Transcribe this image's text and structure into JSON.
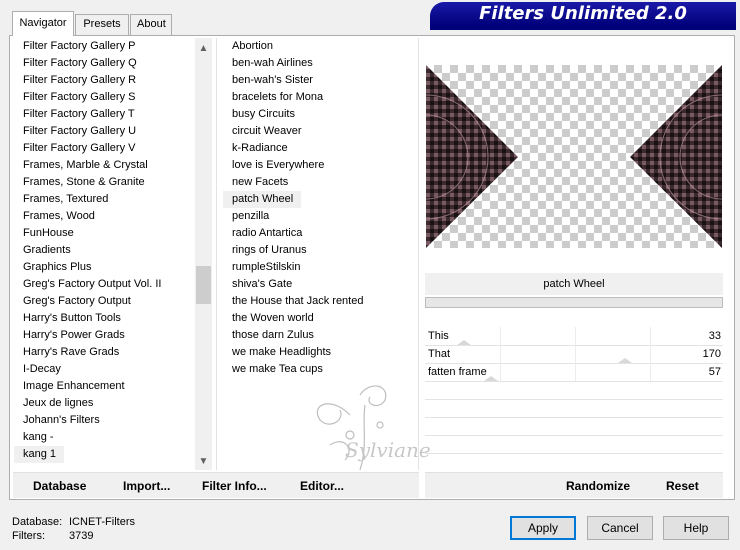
{
  "tabs": [
    {
      "label": "Navigator",
      "active": true
    },
    {
      "label": "Presets",
      "active": false
    },
    {
      "label": "About",
      "active": false
    }
  ],
  "banner": {
    "title": "Filters Unlimited 2.0"
  },
  "categories": {
    "items": [
      "Filter Factory Gallery P",
      "Filter Factory Gallery Q",
      "Filter Factory Gallery R",
      "Filter Factory Gallery S",
      "Filter Factory Gallery T",
      "Filter Factory Gallery U",
      "Filter Factory Gallery V",
      "Frames, Marble & Crystal",
      "Frames, Stone & Granite",
      "Frames, Textured",
      "Frames, Wood",
      "FunHouse",
      "Gradients",
      "Graphics Plus",
      "Greg's Factory Output Vol. II",
      "Greg's Factory Output",
      "Harry's Button Tools",
      "Harry's Power Grads",
      "Harry's Rave Grads",
      "I-Decay",
      "Image Enhancement",
      "Jeux de lignes",
      "Johann's Filters",
      "kang -",
      "kang 1"
    ],
    "selected": "kang 1"
  },
  "filters": {
    "items": [
      "Abortion",
      "ben-wah Airlines",
      "ben-wah's Sister",
      "bracelets for Mona",
      "busy Circuits",
      "circuit Weaver",
      "k-Radiance",
      "love is Everywhere",
      "new Facets",
      "patch Wheel",
      "penzilla",
      "radio Antartica",
      "rings of Uranus",
      "rumpleStilskin",
      "shiva's Gate",
      "the House that Jack rented",
      "the Woven world",
      "those darn Zulus",
      "we make Headlights",
      "we make Tea cups"
    ],
    "selected": "patch Wheel"
  },
  "preview": {
    "filter_name": "patch Wheel"
  },
  "parameters": [
    {
      "name": "This",
      "value": "33",
      "level": 0.13
    },
    {
      "name": "That",
      "value": "170",
      "level": 0.67
    },
    {
      "name": "fatten frame",
      "value": "57",
      "level": 0.22
    }
  ],
  "toolbar": {
    "database_label": "Database",
    "import_label": "Import...",
    "filter_info_label": "Filter Info...",
    "editor_label": "Editor...",
    "randomize_label": "Randomize",
    "reset_label": "Reset"
  },
  "status": {
    "database_key": "Database:",
    "database_val": "ICNET-Filters",
    "filters_key": "Filters:",
    "filters_val": "3739"
  },
  "buttons": {
    "apply": "Apply",
    "cancel": "Cancel",
    "help": "Help"
  },
  "watermark": {
    "text": "Sylviane"
  }
}
